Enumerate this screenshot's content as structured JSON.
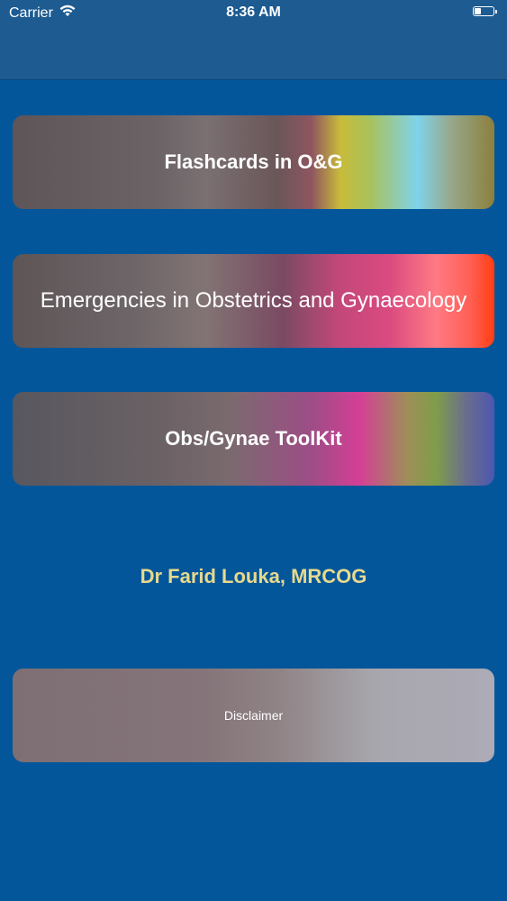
{
  "status_bar": {
    "carrier": "Carrier",
    "time": "8:36 AM",
    "wifi_icon": "wifi-icon",
    "battery_icon": "battery-icon",
    "battery_level": 0.35
  },
  "menu": {
    "flashcards_label": "Flashcards in O&G",
    "emergencies_label": "Emergencies in Obstetrics and Gynaecology",
    "toolkit_label": "Obs/Gynae ToolKit"
  },
  "author": "Dr Farid Louka, MRCOG",
  "disclaimer_label": "Disclaimer",
  "colors": {
    "background": "#04569b",
    "author_text": "#e7d98c"
  }
}
